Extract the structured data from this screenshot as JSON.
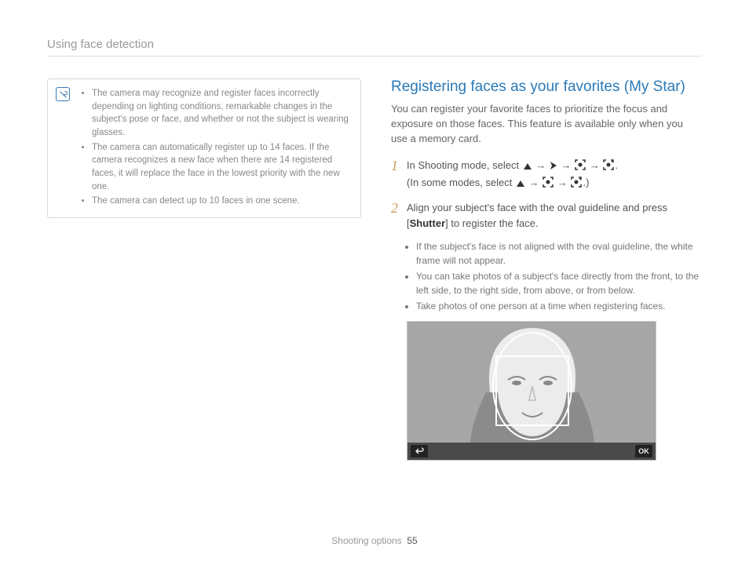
{
  "header": {
    "title": "Using face detection"
  },
  "notes": [
    "The camera may recognize and register faces incorrectly depending on lighting conditions, remarkable changes in the subject's pose or face, and whether or not the subject is wearing glasses.",
    "The camera can automatically register up to 14 faces. If the camera recognizes a new face when there are 14 registered faces, it will replace the face in the lowest priority with the new one.",
    "The camera can detect up to 10 faces in one scene."
  ],
  "section": {
    "title": "Registering faces as your favorites (My Star)",
    "intro": "You can register your favorite faces to prioritize the focus and exposure on those faces. This feature is available only when you use a memory card."
  },
  "steps": {
    "s1a": "In Shooting mode, select ",
    "s1b": ".",
    "s1c": "(In some modes, select ",
    "s1d": ".)",
    "s2a": "Align your subject's face with the oval guideline and press [",
    "s2b": "Shutter",
    "s2c": "] to register the face."
  },
  "subnotes": [
    "If the subject's face is not aligned with the oval guideline, the white frame will not appear.",
    "You can take photos of a subject's face directly from the front, to the left side, to the right side, from above, or from below.",
    "Take photos of one person at a time when registering faces."
  ],
  "illus": {
    "ok": "OK"
  },
  "footer": {
    "section": "Shooting options",
    "page": "55"
  }
}
